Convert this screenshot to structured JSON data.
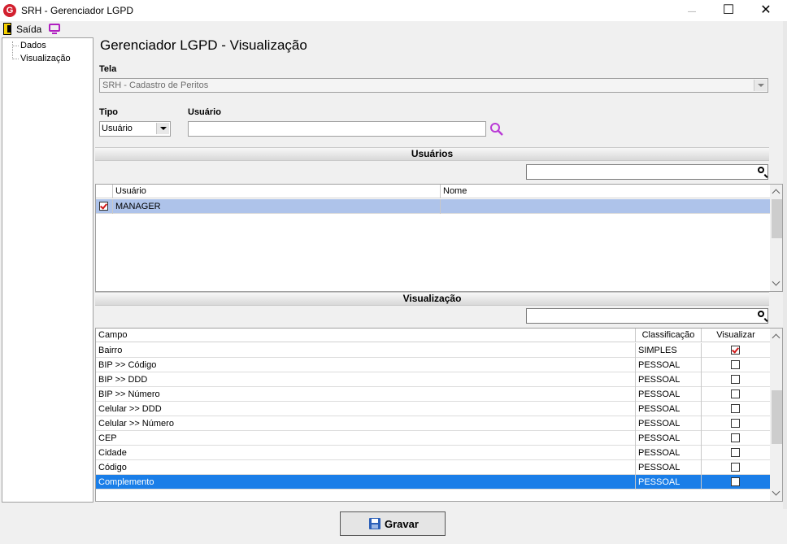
{
  "window": {
    "logo_letter": "G",
    "title": "SRH - Gerenciador LGPD",
    "minimize_glyph": "—",
    "maximize_glyph": "☐",
    "close_glyph": "✕"
  },
  "toolbar": {
    "exit_label": "Saída"
  },
  "tree": {
    "items": [
      "Dados",
      "Visualização"
    ]
  },
  "main": {
    "heading": "Gerenciador LGPD - Visualização",
    "tela": {
      "label": "Tela",
      "value": "SRH - Cadastro de Peritos"
    },
    "tipo": {
      "label": "Tipo",
      "value": "Usuário"
    },
    "usuario": {
      "label": "Usuário",
      "value": ""
    }
  },
  "users_section": {
    "title": "Usuários",
    "search_value": "",
    "columns": [
      "Usuário",
      "Nome"
    ],
    "rows": [
      {
        "checked": true,
        "usuario": "MANAGER",
        "nome": ""
      }
    ]
  },
  "view_section": {
    "title": "Visualização",
    "search_value": "",
    "columns": [
      "Campo",
      "Classificação",
      "Visualizar"
    ],
    "rows": [
      {
        "campo": "Bairro",
        "classificacao": "SIMPLES",
        "visualizar": true
      },
      {
        "campo": "BIP >> Código",
        "classificacao": "PESSOAL",
        "visualizar": false
      },
      {
        "campo": "BIP >> DDD",
        "classificacao": "PESSOAL",
        "visualizar": false
      },
      {
        "campo": "BIP >> Número",
        "classificacao": "PESSOAL",
        "visualizar": false
      },
      {
        "campo": "Celular >> DDD",
        "classificacao": "PESSOAL",
        "visualizar": false
      },
      {
        "campo": "Celular >> Número",
        "classificacao": "PESSOAL",
        "visualizar": false
      },
      {
        "campo": "CEP",
        "classificacao": "PESSOAL",
        "visualizar": false
      },
      {
        "campo": "Cidade",
        "classificacao": "PESSOAL",
        "visualizar": false
      },
      {
        "campo": "Código",
        "classificacao": "PESSOAL",
        "visualizar": false
      },
      {
        "campo": "Complemento",
        "classificacao": "PESSOAL",
        "visualizar": false
      }
    ]
  },
  "footer": {
    "save_label": "Gravar"
  },
  "colors": {
    "selection_blue": "#aec3ea",
    "selection_dark": "#1a7ee8",
    "check_red": "#d01818",
    "logo_red": "#d2202f",
    "search_purple": "#b93bd6"
  }
}
